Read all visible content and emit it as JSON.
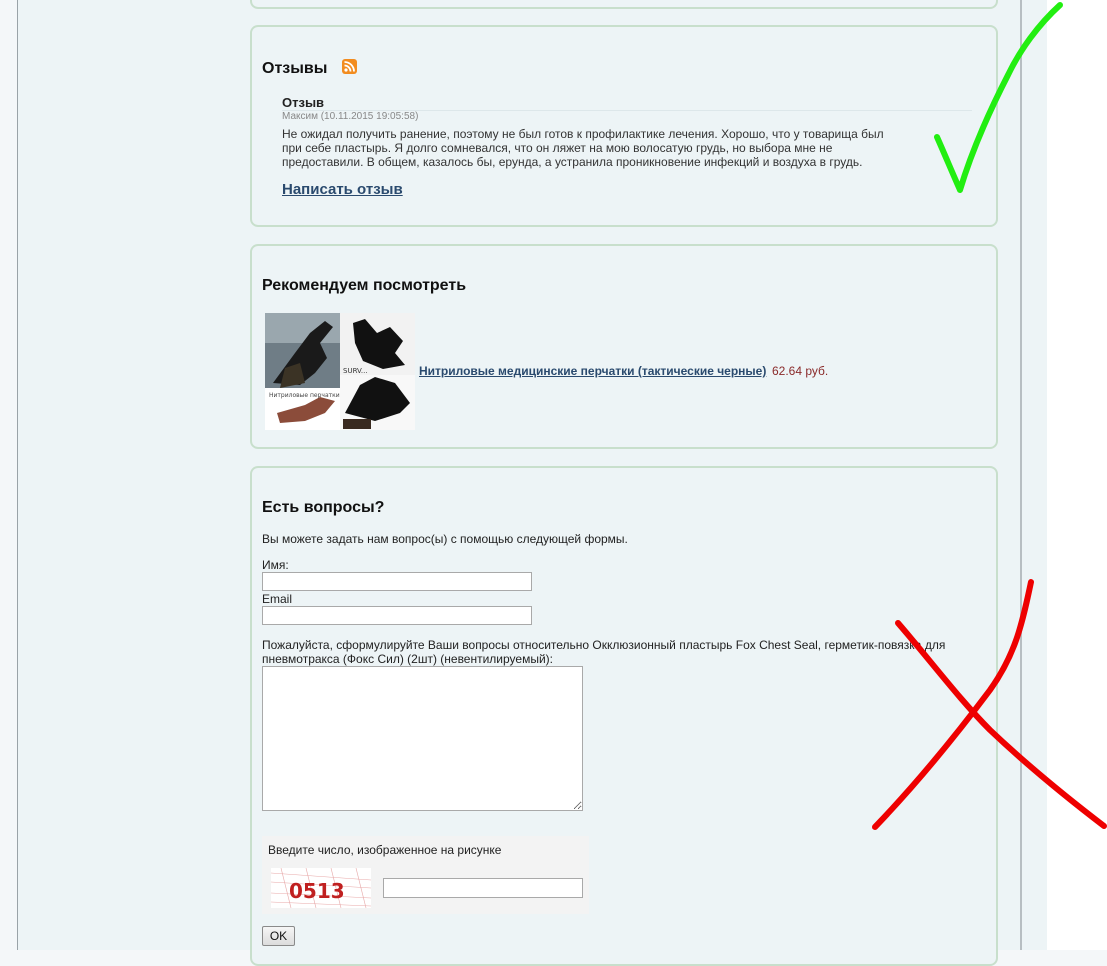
{
  "reviews": {
    "heading": "Отзывы",
    "rss_icon": "rss-icon",
    "item": {
      "title": "Отзыв",
      "meta": "Максим (10.11.2015 19:05:58)",
      "text": "Не ожидал получить ранение, поэтому не был готов к профилактике лечения. Хорошо, что у товарища был при себе пластырь. Я долго сомневался, что он ляжет на мою волосатую грудь, но выбора мне не предоставили. В общем, казалось бы, ерунда, а устранила проникновение инфекций и воздуха в грудь."
    },
    "write_link": "Написать отзыв"
  },
  "recommended": {
    "heading": "Рекомендуем посмотреть",
    "product": {
      "name": "Нитриловые медицинские перчатки (тактические черные)",
      "price": "62.64 руб.",
      "image_caption_brand": "SURV...",
      "image_caption_text": "Нитриловые перчатки"
    }
  },
  "questions": {
    "heading": "Есть вопросы?",
    "intro": "Вы можете задать нам вопрос(ы) с помощью следующей формы.",
    "name_label": "Имя:",
    "name_value": "",
    "email_label": "Email",
    "email_value": "",
    "question_label": "Пожалуйста, сформулируйте Ваши вопросы относительно Окклюзионный пластырь Fox Chest Seal, герметик-повязка для пневмотракса (Фокс Сил) (2шт) (невентилируемый):",
    "question_value": "",
    "captcha_label": "Введите число, изображенное на рисунке",
    "captcha_text": "0513",
    "captcha_value": "",
    "submit_label": "OK"
  },
  "annotations": {
    "check_color": "#22ee11",
    "cross_color": "#ee0000"
  }
}
